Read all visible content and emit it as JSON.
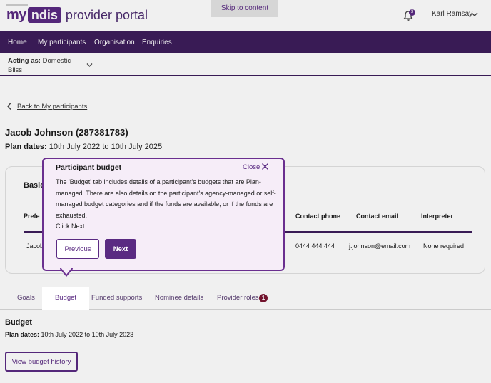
{
  "header": {
    "logo_my": "my",
    "logo_ndis": "ndis",
    "logo_text": "provider portal",
    "skip_link": "Skip to content",
    "notification_count": "3",
    "user_name": "Karl Ramsay"
  },
  "nav": {
    "items": [
      "Home",
      "My participants",
      "Organisation",
      "Enquiries"
    ]
  },
  "acting": {
    "label": "Acting as:",
    "value": "Domestic Bliss"
  },
  "page": {
    "back_link": "Back to My participants",
    "participant_name": "Jacob Johnson (287381783)",
    "plan_dates_label": "Plan dates:",
    "plan_dates_value": "10th July 2022 to 10th July 2025"
  },
  "card": {
    "title": "Basic",
    "headers": [
      "Prefe",
      "Contact phone",
      "Contact email",
      "Interpreter"
    ],
    "row": [
      "Jacob",
      "0444 444 444",
      "j.johnson@email.com",
      "None required"
    ]
  },
  "tabs": {
    "items": [
      "Goals",
      "Budget",
      "Funded supports",
      "Nominee details",
      "Provider roles"
    ],
    "active": "Budget",
    "provider_roles_badge": "1"
  },
  "budget": {
    "heading": "Budget",
    "plan_dates_label": "Plan dates:",
    "plan_dates_value": "10th July 2022 to 10th July 2023",
    "history_button": "View budget history"
  },
  "popup": {
    "title": "Participant budget",
    "close_label": "Close",
    "body": "The 'Budget' tab includes details of a participant's budgets that are Plan-managed. There are also details on the participant's agency-managed or self-managed budget categories and if the funds are available, or if the funds are exhausted.",
    "click_next": "Click Next.",
    "previous_button": "Previous",
    "next_button": "Next"
  },
  "colors": {
    "brand_purple": "#5a2a82",
    "nav_bg": "#3d1d5b",
    "popup_bg": "#f6edf8",
    "badge_red": "#7a1530"
  }
}
